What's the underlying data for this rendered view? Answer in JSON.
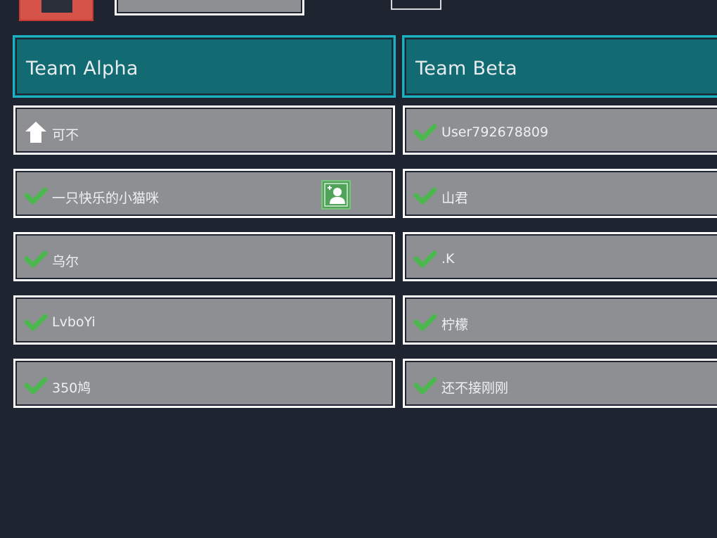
{
  "teams": [
    {
      "title": "Team Alpha",
      "members": [
        {
          "name": "可不",
          "status": "host"
        },
        {
          "name": "一只快乐的小猫咪",
          "status": "ready",
          "add_friend": true
        },
        {
          "name": "乌尔",
          "status": "ready"
        },
        {
          "name": "LvboYi",
          "status": "ready"
        },
        {
          "name": "350鸠",
          "status": "ready"
        }
      ]
    },
    {
      "title": "Team Beta",
      "members": [
        {
          "name": "User792678809",
          "status": "ready",
          "add_friend": true
        },
        {
          "name": "山君",
          "status": "ready",
          "add_friend": true
        },
        {
          "name": ".K",
          "status": "ready",
          "add_friend": true
        },
        {
          "name": "柠檬",
          "status": "ready",
          "add_friend": true
        },
        {
          "name": "还不接刚刚",
          "status": "ready",
          "add_friend": true
        }
      ]
    }
  ],
  "icons": {
    "host": "home-icon",
    "ready": "checkmark-icon",
    "add_friend": "add-user-icon"
  },
  "colors": {
    "background": "#1f2530",
    "team_header": "#126a72",
    "team_header_border": "#1cb2c4",
    "slot": "#8e8f93",
    "check": "#4cb74f",
    "add_button": "#52a35a",
    "exit_button": "#d6534a"
  }
}
